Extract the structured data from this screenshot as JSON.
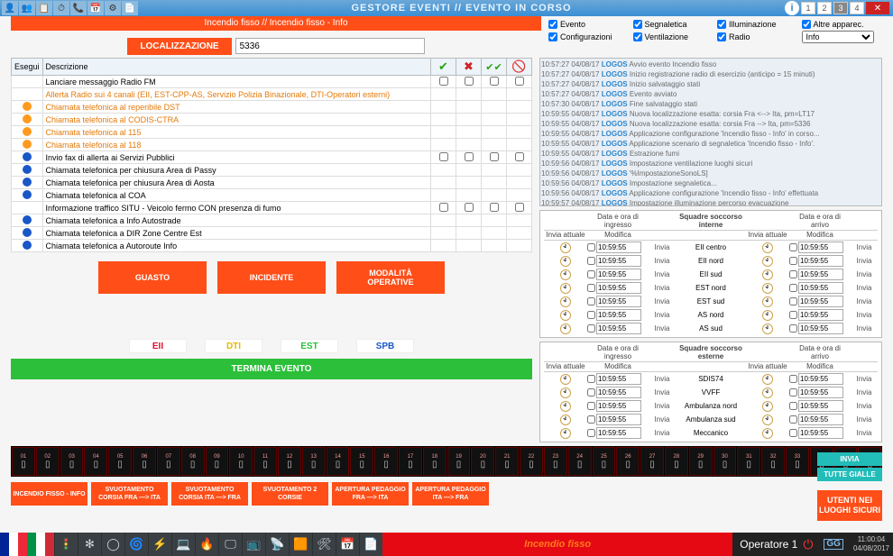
{
  "header": {
    "title": "GESTORE EVENTI // EVENTO IN CORSO",
    "nums": [
      "1",
      "2",
      "3",
      "4"
    ]
  },
  "subtitle": "Incendio fisso // Incendio fisso - Info",
  "checkpanel": {
    "evento": "Evento",
    "segnaletica": "Segnaletica",
    "illuminazione": "Illuminazione",
    "altre": "Altre apparec.",
    "configurazioni": "Configurazioni",
    "ventilazione": "Ventilazione",
    "radio": "Radio",
    "selectv": "Info"
  },
  "loc": {
    "btn": "LOCALIZZAZIONE",
    "val": "5336"
  },
  "table": {
    "hdr": {
      "esegui": "Esegui",
      "desc": "Descrizione"
    },
    "rows": [
      {
        "b": "",
        "txt": "Lanciare messaggio Radio FM",
        "c": true
      },
      {
        "b": "",
        "txt": "Allerta Radio sui 4 canali (EII, EST-CPP-AS, Servizio Polizia Binazionale, DTI-Operatori esterni)",
        "orange": true
      },
      {
        "b": "o",
        "txt": "Chiamata telefonica al reperibile DST",
        "orange": true
      },
      {
        "b": "o",
        "txt": "Chiamata telefonica al CODIS-CTRA",
        "orange": true
      },
      {
        "b": "o",
        "txt": "Chiamata telefonica al 115",
        "orange": true
      },
      {
        "b": "o",
        "txt": "Chiamata telefonica al 118",
        "orange": true
      },
      {
        "b": "bl",
        "txt": "Invio fax di allerta ai Servizi Pubblici",
        "c": true
      },
      {
        "b": "bl",
        "txt": "Chiamata telefonica per chiusura Area di Passy"
      },
      {
        "b": "bl",
        "txt": "Chiamata telefonica per chiusura Area di Aosta"
      },
      {
        "b": "bl",
        "txt": "Chiamata telefonica al COA"
      },
      {
        "b": "",
        "txt": "Informazione traffico SITU - Veicolo fermo CON presenza di fumo",
        "c": true
      },
      {
        "b": "bl",
        "txt": "Chiamata telefonica a Info Autostrade"
      },
      {
        "b": "bl",
        "txt": "Chiamata telefonica a DIR Zone Centre Est"
      },
      {
        "b": "bl",
        "txt": "Chiamata telefonica a Autoroute Info"
      }
    ]
  },
  "btns": {
    "guasto": "GUASTO",
    "incidente": "INCIDENTE",
    "modalita": "MODALITÀ OPERATIVE"
  },
  "tags": {
    "eii": "EII",
    "dti": "DTI",
    "est": "EST",
    "spb": "SPB"
  },
  "termina": "TERMINA EVENTO",
  "log": [
    "10:57:27 04/08/17 |LOGOS| Avvio evento Incendio fisso",
    "10:57:27 04/08/17 |LOGOS| Inizio registrazione radio di esercizio (anticipo = 15 minuti)",
    "10:57:27 04/08/17 |LOGOS| Inizio salvataggio stati",
    "10:57:27 04/08/17 |LOGOS| Evento avviato",
    "10:57:30 04/08/17 |LOGOS| Fine salvataggio stati",
    "10:59:55 04/08/17 |LOGOS| Nuova localizzazione esatta: corsia Fra <--> Ita, pm=LT17",
    "10:59:55 04/08/17 |LOGOS| Nuova localizzazione esatta: corsia Fra --> Ita, pm=5336",
    "10:59:55 04/08/17 |LOGOS| Applicazione configurazione 'Incendio fisso - Info' in corso...",
    "10:59:55 04/08/17 |LOGOS| Applicazione scenario di segnaletica 'Incendio fisso - Info'.",
    "10:59:55 04/08/17 |LOGOS| Estrazione fumi",
    "10:59:56 04/08/17 |LOGOS| Impostazione ventilazione luoghi sicuri",
    "10:59:56 04/08/17 |LOGOS| '%ImpostazioneSonoLS]",
    "10:59:56 04/08/17 |LOGOS| Impostazione segnaletica...",
    "10:59:56 04/08/17 |LOGOS| Applicazione configurazione 'Incendio fisso - Info' effettuata",
    "10:59:57 04/08/17 |LOGOS| Impostazione illuminazione percorso evacuazione"
  ],
  "squad1": {
    "title": "Squadre soccorso interne",
    "h": {
      "ingresso": "Data e ora di ingresso",
      "arrivo": "Data e ora di arrivo",
      "inv": "Invia attuale",
      "mod": "Modifica"
    },
    "rows": [
      {
        "t": "10:59:55",
        "n": "EII centro"
      },
      {
        "t": "10:59:55",
        "n": "EII nord"
      },
      {
        "t": "10:59:55",
        "n": "EII sud"
      },
      {
        "t": "10:59:55",
        "n": "EST nord"
      },
      {
        "t": "10:59:55",
        "n": "EST sud"
      },
      {
        "t": "10:59:55",
        "n": "AS nord"
      },
      {
        "t": "10:59:55",
        "n": "AS sud"
      }
    ],
    "invia": "Invia"
  },
  "squad2": {
    "title": "Squadre soccorso esterne",
    "rows": [
      {
        "t": "10:59:55",
        "n": "SDIS74"
      },
      {
        "t": "10:59:55",
        "n": "VVFF"
      },
      {
        "t": "10:59:55",
        "n": "Ambulanza nord"
      },
      {
        "t": "10:59:55",
        "n": "Ambulanza sud"
      },
      {
        "t": "10:59:55",
        "n": "Meccanico"
      }
    ]
  },
  "footer": {
    "invia": "INVIA",
    "tutte": "TUTTE GIALLE",
    "evts": [
      "INCENDIO FISSO - INFO",
      "SVUOTAMENTO CORSIA FRA —> ITA",
      "SVUOTAMENTO CORSIA ITA —> FRA",
      "SVUOTAMENTO 2 CORSIE",
      "APERTURA PEDAGGIO FRA —> ITA",
      "APERTURA PEDAGGIO ITA —> FRA"
    ],
    "utenti": "UTENTI NEI LUOGHI SICURI",
    "alarm": "Incendio fisso",
    "oper": "Operatore 1",
    "time": "11:00:04",
    "date": "04/08/2017"
  }
}
